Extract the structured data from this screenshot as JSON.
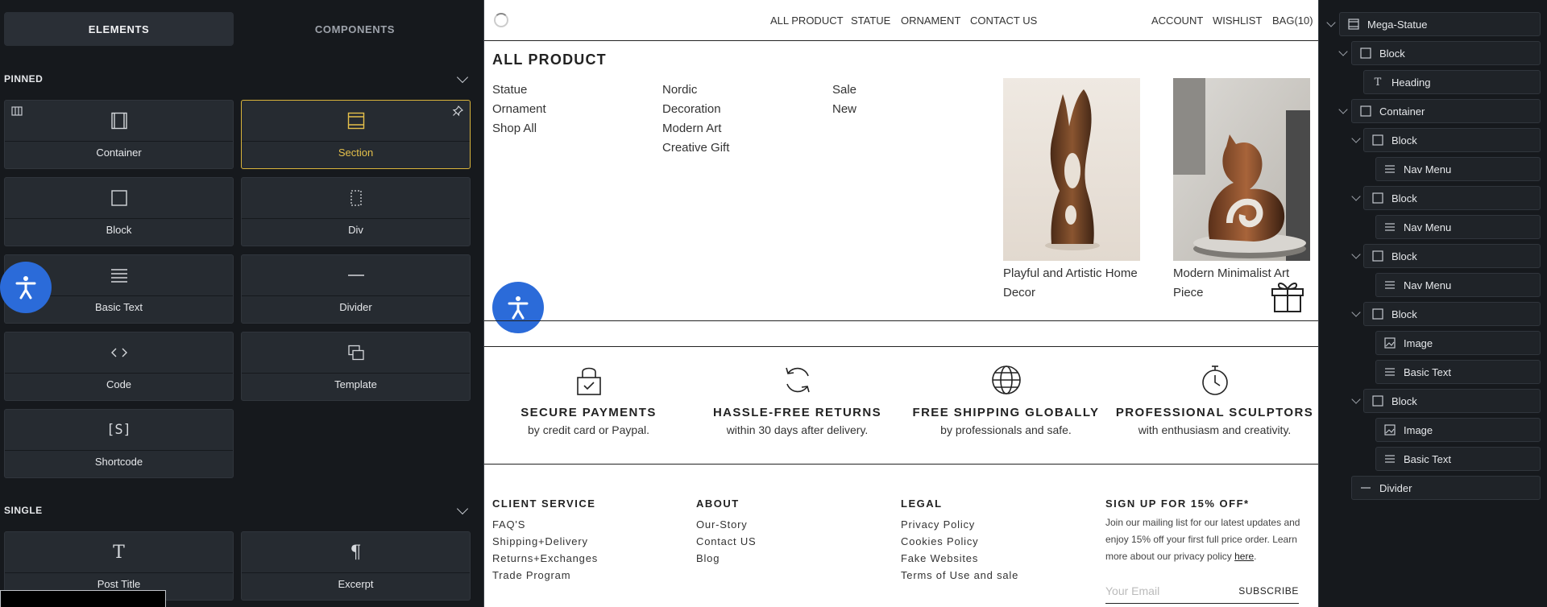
{
  "left_panel": {
    "tabs": [
      "ELEMENTS",
      "COMPONENTS"
    ],
    "pinned_title": "PINNED",
    "pinned": [
      {
        "label": "Container",
        "icon": "container-icon"
      },
      {
        "label": "Section",
        "icon": "section-icon",
        "selected": true
      },
      {
        "label": "Block",
        "icon": "block-icon"
      },
      {
        "label": "Div",
        "icon": "div-icon"
      },
      {
        "label": "Basic Text",
        "icon": "text-lines-icon"
      },
      {
        "label": "Divider",
        "icon": "divider-icon"
      },
      {
        "label": "Code",
        "icon": "code-icon"
      },
      {
        "label": "Template",
        "icon": "template-icon"
      },
      {
        "label": "Shortcode",
        "icon": "shortcode-icon"
      }
    ],
    "single_title": "SINGLE",
    "single": [
      {
        "label": "Post Title",
        "icon": "title-icon"
      },
      {
        "label": "Excerpt",
        "icon": "paragraph-icon"
      }
    ],
    "shortcode_glyph": "[S]"
  },
  "preview": {
    "nav": {
      "links": [
        "ALL PRODUCT",
        "STATUE",
        "ORNAMENT",
        "CONTACT US"
      ],
      "account": "ACCOUNT",
      "wishlist": "WISHLIST",
      "bag": "BAG(10)"
    },
    "mega": {
      "title": "ALL PRODUCT",
      "col1": [
        "Statue",
        "Ornament",
        "Shop All"
      ],
      "col2": [
        "Nordic",
        "Decoration",
        "Modern Art",
        "Creative Gift"
      ],
      "col3": [
        "Sale",
        "New"
      ],
      "products": [
        {
          "caption_1": "Playful and Artistic Home",
          "caption_2": "Decor"
        },
        {
          "caption_1": "Modern Minimalist Art",
          "caption_2": "Piece"
        }
      ]
    },
    "features": [
      {
        "title": "SECURE PAYMENTS",
        "sub": "by credit card or Paypal.",
        "icon": "lock-icon"
      },
      {
        "title": "HASSLE-FREE RETURNS",
        "sub": "within 30 days after delivery.",
        "icon": "refresh-icon"
      },
      {
        "title": "FREE SHIPPING GLOBALLY",
        "sub": "by professionals and safe.",
        "icon": "globe-icon"
      },
      {
        "title": "PROFESSIONAL SCULPTORS",
        "sub": "with enthusiasm and creativity.",
        "icon": "stopwatch-icon"
      }
    ],
    "footer": {
      "client": {
        "title": "CLIENT SERVICE",
        "links": [
          "FAQ'S",
          "Shipping+Delivery",
          "Returns+Exchanges",
          "Trade Program"
        ]
      },
      "about": {
        "title": "ABOUT",
        "links": [
          "Our-Story",
          "Contact US",
          "Blog"
        ]
      },
      "legal": {
        "title": "LEGAL",
        "links": [
          "Privacy Policy",
          "Cookies Policy",
          "Fake Websites",
          "Terms of Use and sale"
        ]
      },
      "signup": {
        "title": "SIGN UP FOR 15% OFF*",
        "text": "Join our mailing list for our latest updates and enjoy 15% off your first full price order. Learn more about our privacy policy",
        "link": "here",
        "after_link": ".",
        "placeholder": "Your Email",
        "button": "SUBSCRIBE"
      }
    }
  },
  "structure": {
    "nodes": [
      {
        "label": "Mega-Statue",
        "icon": "section-icon"
      },
      {
        "label": "Block",
        "icon": "block-icon"
      },
      {
        "label": "Heading",
        "icon": "heading-icon"
      },
      {
        "label": "Container",
        "icon": "block-icon"
      },
      {
        "label": "Block",
        "icon": "block-icon"
      },
      {
        "label": "Nav Menu",
        "icon": "menu-icon"
      },
      {
        "label": "Block",
        "icon": "block-icon"
      },
      {
        "label": "Nav Menu",
        "icon": "menu-icon"
      },
      {
        "label": "Block",
        "icon": "block-icon"
      },
      {
        "label": "Nav Menu",
        "icon": "menu-icon"
      },
      {
        "label": "Block",
        "icon": "block-icon"
      },
      {
        "label": "Image",
        "icon": "image-icon"
      },
      {
        "label": "Basic Text",
        "icon": "text-lines-icon"
      },
      {
        "label": "Block",
        "icon": "block-icon"
      },
      {
        "label": "Image",
        "icon": "image-icon"
      },
      {
        "label": "Basic Text",
        "icon": "text-lines-icon"
      },
      {
        "label": "Divider",
        "icon": "divider-icon"
      }
    ]
  },
  "colors": {
    "accent": "#d9b43b",
    "accessibility": "#2b6bd9",
    "panel_bg": "#16191d",
    "card_bg": "#262b31"
  }
}
